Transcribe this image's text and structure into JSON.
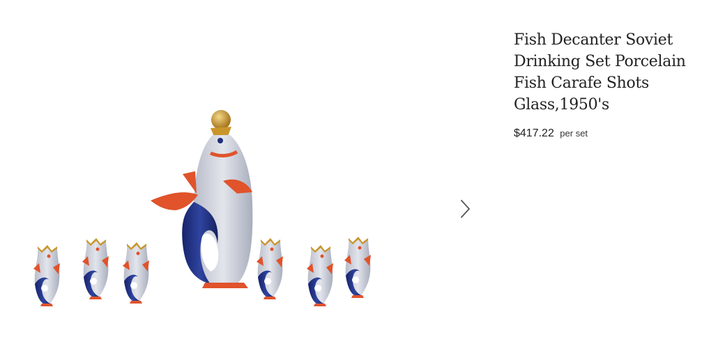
{
  "product": {
    "title": "Fish Decanter Soviet Drinking Set Porcelain Fish Carafe Shots Glass,1950's",
    "price": "$417.22",
    "price_unit": "per set"
  },
  "gallery": {
    "image_alt": "Porcelain fish decanter with six fish-shaped shot glasses",
    "next_icon": "chevron-right-icon"
  },
  "colors": {
    "porcelain_blue": "#1f2f7a",
    "porcelain_white": "#c9ccd6",
    "accent_orange": "#e0532b",
    "gold": "#c9962a"
  }
}
